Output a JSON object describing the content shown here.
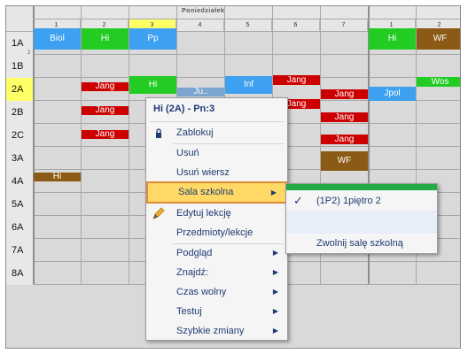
{
  "header": {
    "day": "Poniedziałek",
    "columns": [
      "1",
      "2",
      "3",
      "4",
      "5",
      "6",
      "7",
      "1",
      "2"
    ],
    "selected_column": 2
  },
  "rows": [
    "1A",
    "1B",
    "2A",
    "2B",
    "2C",
    "3A",
    "4A",
    "5A",
    "6A",
    "7A",
    "8A"
  ],
  "row_1a_subscript": "2",
  "selected_row": "2A",
  "lessons": {
    "r1a_c1": "Biol",
    "r1a_c2": "Hi",
    "r1a_c3": "Pp",
    "r1a_c8": "Hi",
    "r1a_c9": "WF",
    "r2a_c2": "Jang",
    "r2a_c3": "Hi",
    "r2a_c4": "Ju..",
    "r2a_c5": "Inf",
    "r2a_c6": "Jang",
    "r2a_c7": "Jang",
    "r2a_c8": "Jpol",
    "r2a_c9": "Wos",
    "r2b_c2": "Jang",
    "r2b_c6": "Jang",
    "r2b_c7": "Jang",
    "r2c_c2": "Jang",
    "r2c_c7": "Jang",
    "r3a_c7": "WF",
    "r4a_c1": "Hi"
  },
  "colors": {
    "blue": "#3da0f0",
    "green": "#22cc22",
    "red": "#cc0000",
    "brown": "#8b5a14",
    "yellow_sel": "#ffff66",
    "menu_text": "#1f3b73",
    "highlight": "#ffd966",
    "highlight_border": "#e08a3a"
  },
  "context_menu": {
    "title": "Hi (2A) - Pn:3",
    "items": [
      {
        "label": "Zablokuj",
        "icon": "lock-icon"
      },
      {
        "label": "Usuń"
      },
      {
        "label": "Usuń wiersz"
      },
      {
        "label": "Sala szkolna",
        "submenu": true
      },
      {
        "label": "Edytuj lekcję",
        "icon": "pencil-icon"
      },
      {
        "label": "Przedmioty/lekcje"
      },
      {
        "label": "Podgląd",
        "submenu": true
      },
      {
        "label": "Znajdź:",
        "submenu": true
      },
      {
        "label": "Czas wolny",
        "submenu": true
      },
      {
        "label": "Testuj",
        "submenu": true
      },
      {
        "label": "Szybkie zmiany",
        "submenu": true
      }
    ]
  },
  "submenu": {
    "items": [
      {
        "label": "(1P2) 1piętro 2",
        "checked": true
      },
      {
        "label": ""
      },
      {
        "label": "Zwolnij salę szkolną"
      }
    ]
  }
}
